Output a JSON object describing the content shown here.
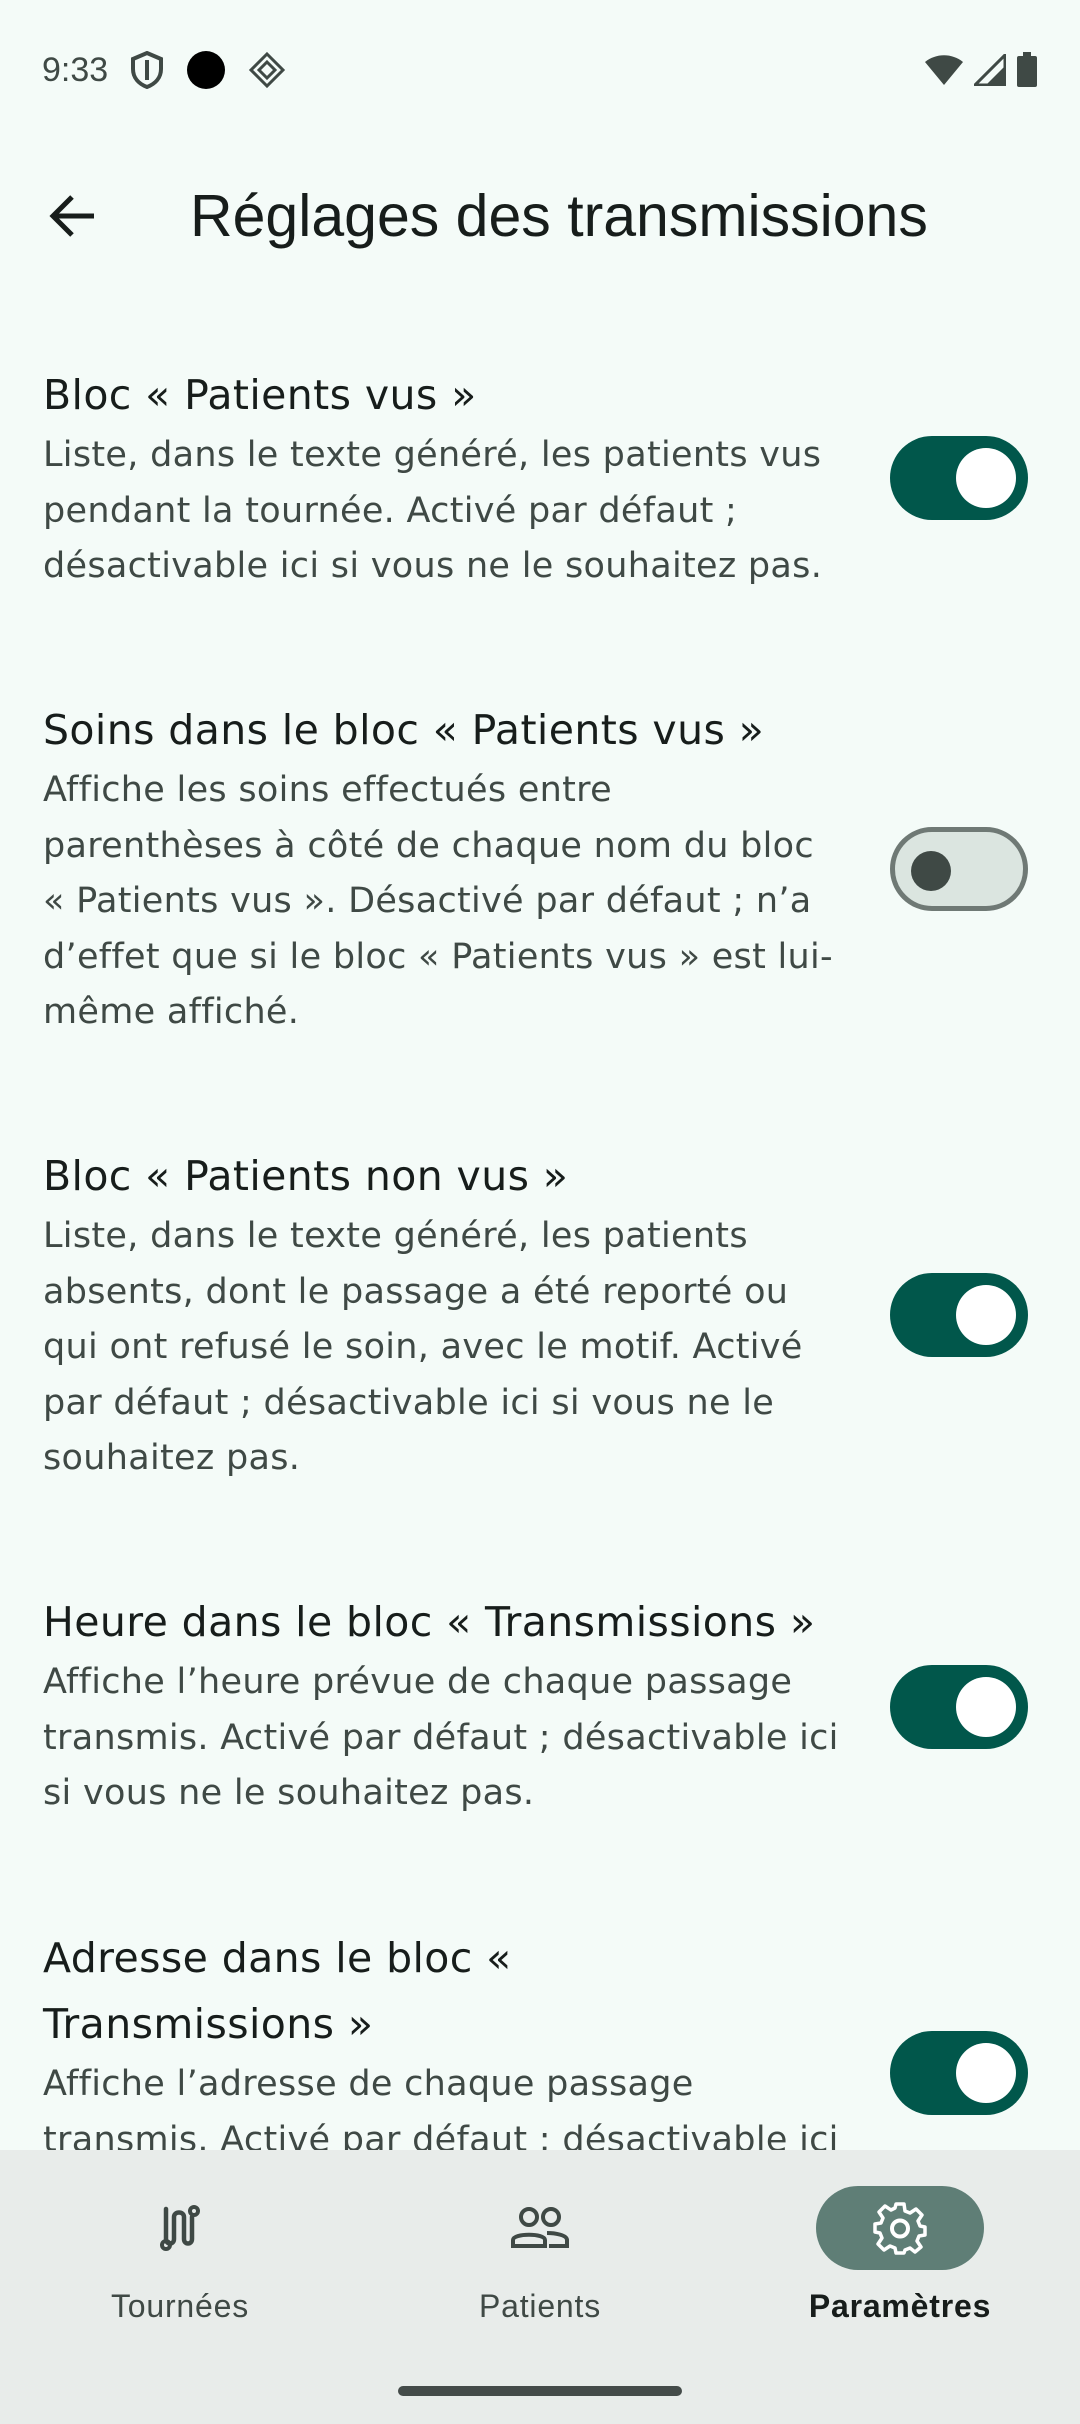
{
  "status_bar": {
    "time": "9:33",
    "icons_left": [
      "shield-icon",
      "record-dot-icon",
      "diamond-icon"
    ],
    "icons_right": [
      "wifi-icon",
      "cell-signal-icon",
      "battery-icon"
    ]
  },
  "app_bar": {
    "back_icon": "arrow-back-icon",
    "title": "Réglages des transmissions"
  },
  "settings": [
    {
      "title": "Bloc « Patients vus »",
      "description": "Liste, dans le texte généré, les patients vus pendant la tournée. Activé par défaut ; désactivable ici si vous ne le souhaitez pas.",
      "enabled": true
    },
    {
      "title": "Soins dans le bloc « Patients vus »",
      "description": "Affiche les soins effectués entre parenthèses à côté de chaque nom du bloc « Patients vus ». Désactivé par défaut ; n’a d’effet que si le bloc « Patients vus » est lui-même affiché.",
      "enabled": false
    },
    {
      "title": "Bloc « Patients non vus »",
      "description": "Liste, dans le texte généré, les patients absents, dont le passage a été reporté ou qui ont refusé le soin, avec le motif. Activé par défaut ; désactivable ici si vous ne le souhaitez pas.",
      "enabled": true
    },
    {
      "title": "Heure dans le bloc « Transmissions »",
      "description": "Affiche l’heure prévue de chaque passage transmis. Activé par défaut ; désactivable ici si vous ne le souhaitez pas.",
      "enabled": true
    },
    {
      "title": "Adresse dans le bloc « Transmissions »",
      "description": "Affiche l’adresse de chaque passage transmis. Activé par défaut ; désactivable ici",
      "enabled": true
    }
  ],
  "bottom_nav": {
    "items": [
      {
        "label": "Tournées",
        "icon": "route-icon",
        "active": false
      },
      {
        "label": "Patients",
        "icon": "people-icon",
        "active": false
      },
      {
        "label": "Paramètres",
        "icon": "gear-icon",
        "active": true
      }
    ]
  },
  "colors": {
    "background": "#f4fbf8",
    "switch_on": "#01574b",
    "nav_active": "#5f7e76",
    "nav_background": "#e8ecea"
  }
}
